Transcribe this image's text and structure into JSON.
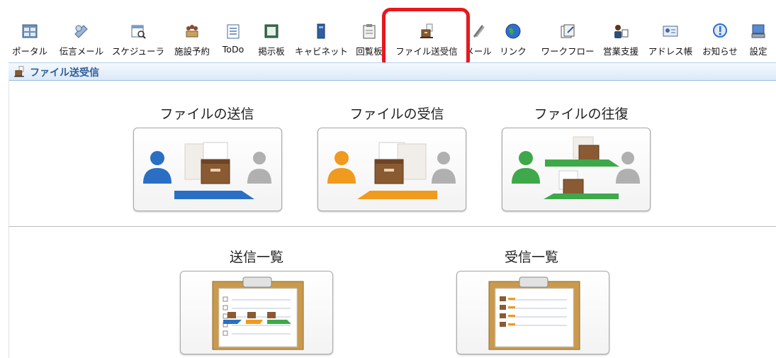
{
  "toolbar": {
    "items": [
      {
        "label": "ポータル",
        "icon": "portal-icon"
      },
      {
        "label": "伝言メール",
        "icon": "message-mail-icon"
      },
      {
        "label": "スケジューラ",
        "icon": "scheduler-icon"
      },
      {
        "label": "施設予約",
        "icon": "facility-reservation-icon"
      },
      {
        "label": "ToDo",
        "icon": "todo-icon"
      },
      {
        "label": "掲示板",
        "icon": "bulletin-board-icon"
      },
      {
        "label": "キャビネット",
        "icon": "cabinet-icon"
      },
      {
        "label": "回覧板",
        "icon": "circular-icon"
      },
      {
        "label": "ファイル送受信",
        "icon": "file-transfer-icon"
      },
      {
        "label": "メール",
        "icon": "mail-icon"
      },
      {
        "label": "リンク",
        "icon": "link-globe-icon"
      },
      {
        "label": "ワークフロー",
        "icon": "workflow-icon"
      },
      {
        "label": "営業支援",
        "icon": "sales-support-icon"
      },
      {
        "label": "アドレス帳",
        "icon": "address-book-icon"
      },
      {
        "label": "お知らせ",
        "icon": "notification-icon"
      },
      {
        "label": "設定",
        "icon": "settings-icon"
      }
    ]
  },
  "section": {
    "title": "ファイル送受信",
    "icon": "file-transfer-icon"
  },
  "cards": {
    "send": {
      "title": "ファイルの送信"
    },
    "receive": {
      "title": "ファイルの受信"
    },
    "roundtrip": {
      "title": "ファイルの往復"
    },
    "sent_list": {
      "title": "送信一覧"
    },
    "recv_list": {
      "title": "受信一覧"
    }
  },
  "colors": {
    "highlight": "#e8181d",
    "blue": "#2a6fc4",
    "orange": "#f09a1e",
    "green": "#3fa84a",
    "gray": "#b0b0b0",
    "box": "#8a5a32"
  }
}
